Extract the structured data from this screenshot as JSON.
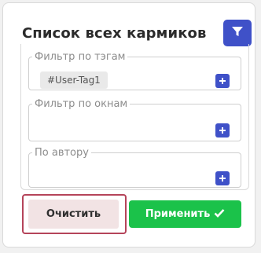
{
  "panel": {
    "title": "Список всех кармиков",
    "filter_button_icon": "funnel-icon"
  },
  "filters": [
    {
      "legend": "Фильтр по тэгам",
      "tags": [
        "#User-Tag1"
      ],
      "add_icon": "plus-icon"
    },
    {
      "legend": "Фильтр по окнам",
      "tags": [],
      "add_icon": "plus-icon"
    },
    {
      "legend": "По автору",
      "tags": [],
      "add_icon": "plus-icon"
    }
  ],
  "actions": {
    "clear_label": "Очистить",
    "apply_label": "Применить",
    "apply_icon": "checkmark-icon"
  },
  "colors": {
    "accent_blue": "#3f51c8",
    "apply_green": "#1bc24a",
    "clear_bg": "#f2e3e4",
    "clear_focus_border": "#b5445a"
  }
}
